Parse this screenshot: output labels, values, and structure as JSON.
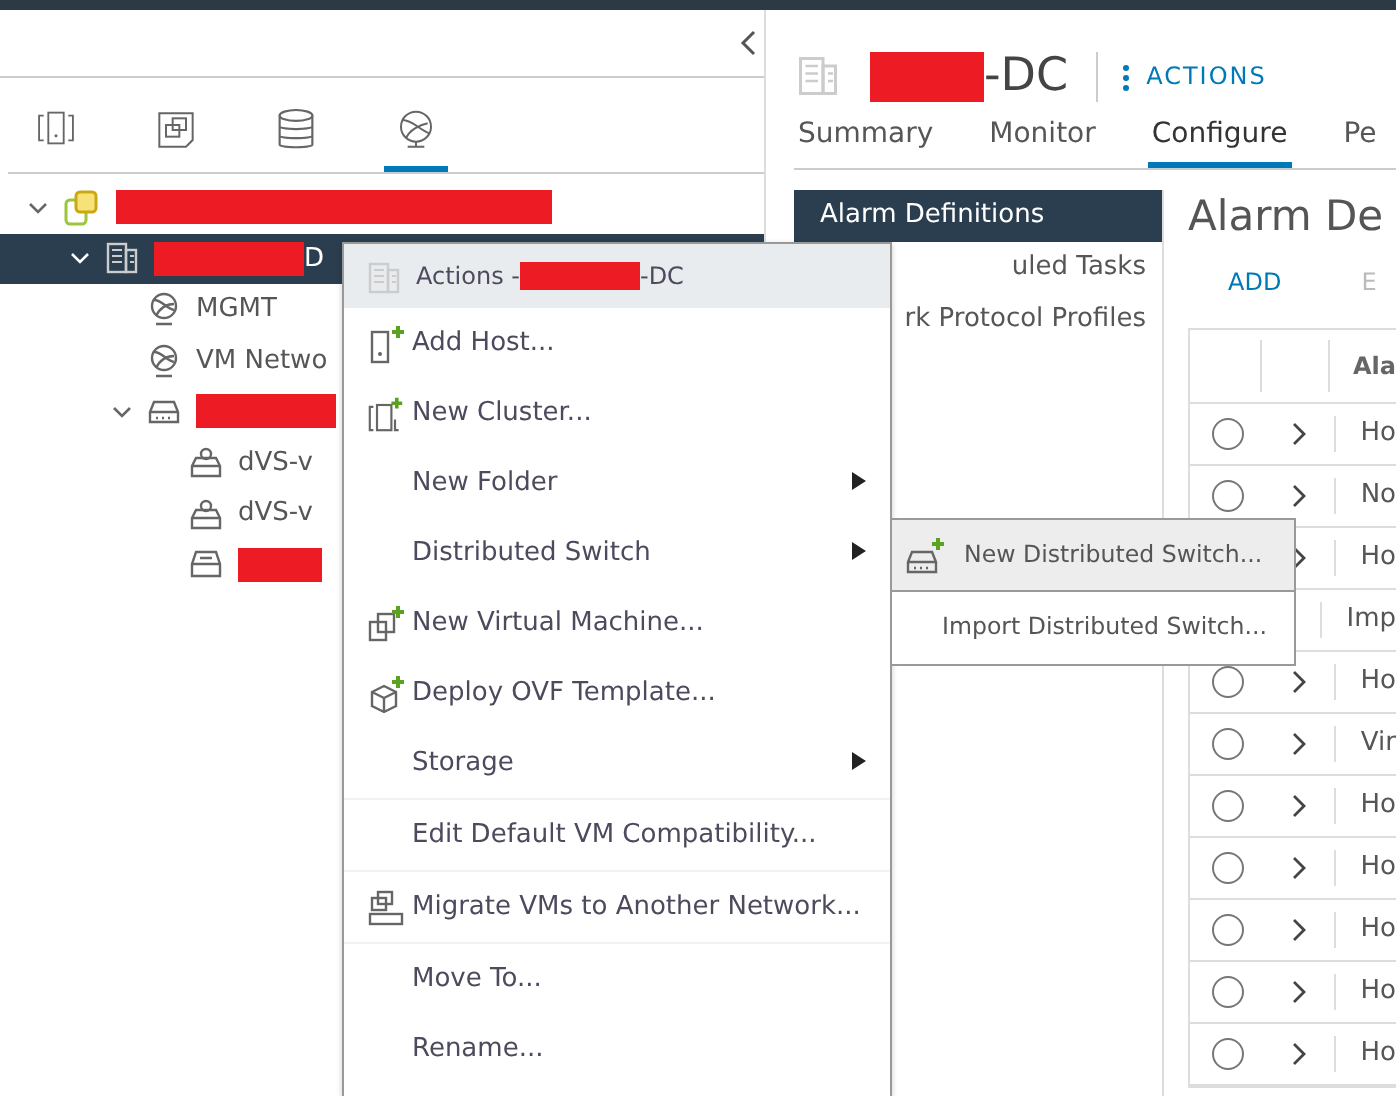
{
  "view_tabs": [
    {
      "kind": "hosts",
      "selected": false
    },
    {
      "kind": "vms",
      "selected": false
    },
    {
      "kind": "storage",
      "selected": false
    },
    {
      "kind": "network",
      "selected": true
    }
  ],
  "tree": [
    {
      "kind": "vcenter",
      "redacted": true,
      "expanded": true,
      "selected": false,
      "children": [
        {
          "kind": "datacenter",
          "redacted": true,
          "label": "D",
          "expanded": true,
          "selected": true,
          "children": [
            {
              "kind": "network",
              "label": "MGMT",
              "selected": false
            },
            {
              "kind": "network",
              "label": "VM Netwo",
              "selected": false
            },
            {
              "kind": "switch",
              "redacted": true,
              "expanded": true,
              "selected": false,
              "children": [
                {
                  "kind": "portgroup",
                  "label": "dVS-v",
                  "selected": false
                },
                {
                  "kind": "portgroup",
                  "label": "dVS-v",
                  "selected": false
                },
                {
                  "kind": "uplink",
                  "redacted": true,
                  "selected": false
                }
              ]
            }
          ]
        }
      ]
    }
  ],
  "object_header": {
    "redacted": true,
    "title": "-DC",
    "actions": "ACTIONS"
  },
  "tabs": [
    {
      "label": "Summary",
      "selected": false
    },
    {
      "label": "Monitor",
      "selected": false
    },
    {
      "label": "Configure",
      "selected": true
    },
    {
      "label": "Pe",
      "selected": false
    }
  ],
  "side_nav": [
    {
      "label": "Alarm Definitions",
      "selected": true
    },
    {
      "label": "uled Tasks",
      "selected": false
    },
    {
      "label": "rk Protocol Profiles",
      "selected": false
    }
  ],
  "content": {
    "title": "Alarm De",
    "add": "ADD",
    "edit": "E",
    "table": {
      "columns": [
        "Ala"
      ],
      "rows": [
        {
          "selected": false,
          "column_3": "Ho"
        },
        {
          "selected": false,
          "column_3": "No"
        },
        {
          "column_3": "Ho"
        },
        {
          "column_3": "Imp"
        },
        {
          "selected": false,
          "column_3": "Ho"
        },
        {
          "selected": false,
          "column_3": "Vir"
        },
        {
          "selected": false,
          "column_3": "Ho"
        },
        {
          "selected": false,
          "column_3": "Ho"
        },
        {
          "selected": false,
          "column_3": "Ho"
        },
        {
          "selected": false,
          "column_3": "Ho"
        },
        {
          "selected": false,
          "column_3": "Ho"
        }
      ]
    }
  },
  "context_menu": {
    "header": {
      "label": "Actions - ",
      "redacted": true,
      "suffix": "-DC"
    },
    "items": [
      {
        "kind": "item",
        "label": "Add Host..."
      },
      {
        "kind": "item",
        "label": "New Cluster..."
      },
      {
        "kind": "submenu",
        "label": "New Folder"
      },
      {
        "kind": "submenu",
        "label": "Distributed Switch"
      },
      {
        "kind": "item",
        "label": "New Virtual Machine..."
      },
      {
        "kind": "item",
        "label": "Deploy OVF Template..."
      },
      {
        "kind": "submenu",
        "label": "Storage"
      },
      {
        "kind": "divider"
      },
      {
        "kind": "item",
        "label": "Edit Default VM Compatibility..."
      },
      {
        "kind": "divider"
      },
      {
        "kind": "item",
        "label": "Migrate VMs to Another Network..."
      },
      {
        "kind": "divider"
      },
      {
        "kind": "item",
        "label": "Move To..."
      },
      {
        "kind": "item",
        "label": "Rename..."
      }
    ]
  },
  "submenu": {
    "items": [
      {
        "label": "New Distributed Switch...",
        "selected": true
      },
      {
        "label": "Import Distributed Switch...",
        "selected": false
      }
    ]
  }
}
